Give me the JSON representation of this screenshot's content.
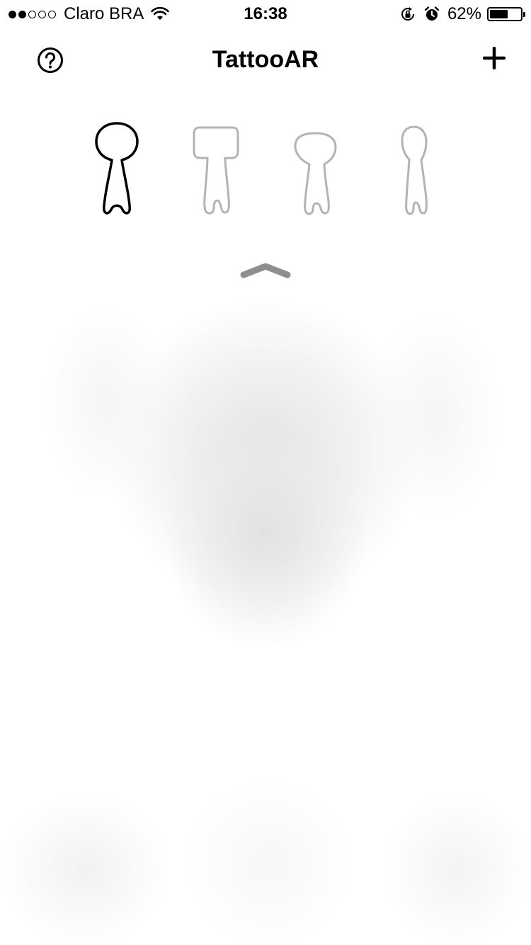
{
  "status_bar": {
    "signal": {
      "filled": 2,
      "total": 5
    },
    "carrier": "Claro BRA",
    "time": "16:38",
    "battery_percent_text": "62%",
    "battery_level": 0.62,
    "icons": [
      "wifi-icon",
      "rotation-lock-icon",
      "alarm-icon",
      "battery-icon"
    ]
  },
  "nav": {
    "title": "TattooAR",
    "left_icon": "help-icon",
    "right_icon": "add-icon"
  },
  "body_selector": {
    "options": [
      {
        "name": "head-front",
        "selected": true
      },
      {
        "name": "torso",
        "selected": false
      },
      {
        "name": "head-back",
        "selected": false
      },
      {
        "name": "head-side",
        "selected": false
      }
    ],
    "selected_color": "#000000",
    "unselected_color": "#b3b3b3"
  },
  "pull_tab": {
    "icon": "chevron-up-icon",
    "color": "#8e8e8e"
  },
  "camera_preview": {
    "state": "blurred"
  }
}
